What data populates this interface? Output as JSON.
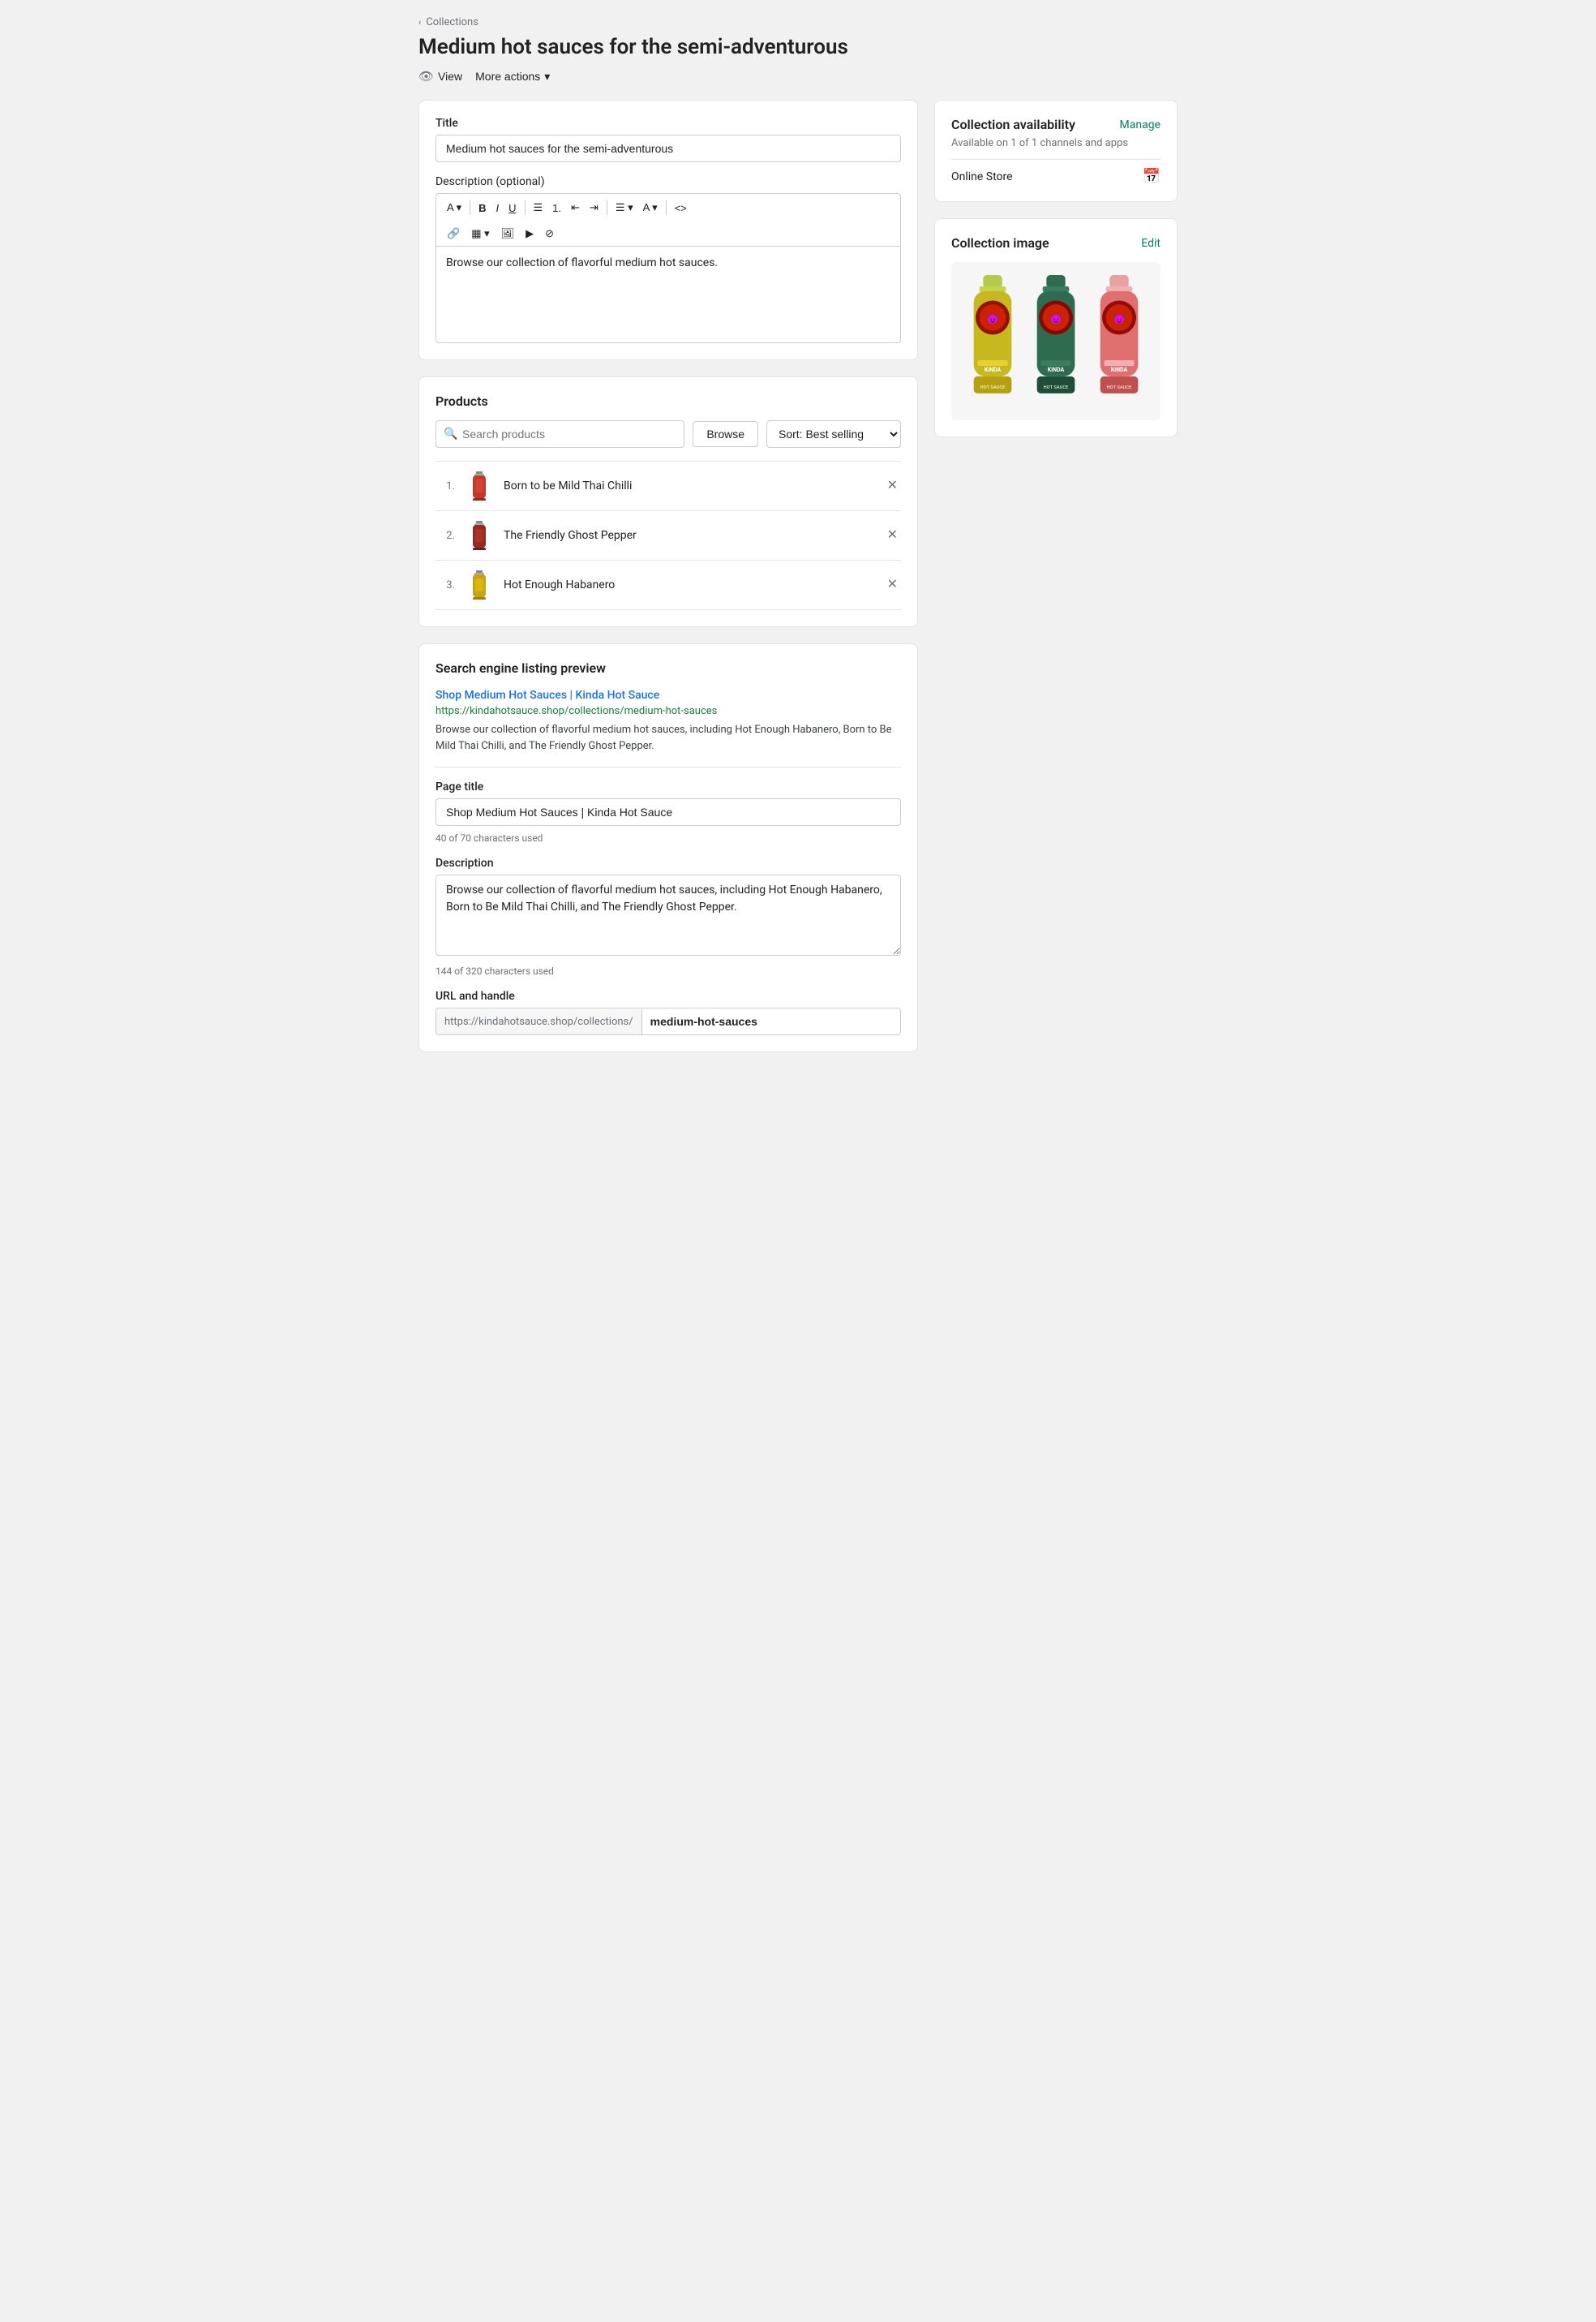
{
  "breadcrumb": {
    "label": "Collections",
    "chevron": "‹"
  },
  "page": {
    "title": "Medium hot sauces for the semi-adventurous"
  },
  "actions": {
    "view_label": "View",
    "more_actions_label": "More actions"
  },
  "title_field": {
    "label": "Title",
    "value": "Medium hot sauces for the semi-adventurous"
  },
  "description_field": {
    "label": "Description (optional)",
    "value": "Browse our collection of flavorful medium hot sauces."
  },
  "products": {
    "header": "Products",
    "search_placeholder": "Search products",
    "browse_label": "Browse",
    "sort_label": "Sort: Best selling",
    "items": [
      {
        "num": "1.",
        "name": "Born to be Mild Thai Chilli",
        "color": "#c0392b"
      },
      {
        "num": "2.",
        "name": "The Friendly Ghost Pepper",
        "color": "#922b21"
      },
      {
        "num": "3.",
        "name": "Hot Enough Habanero",
        "color": "#d4ac0d"
      }
    ]
  },
  "seo": {
    "header": "Search engine listing preview",
    "preview_title": "Shop Medium Hot Sauces | Kinda Hot Sauce",
    "preview_url": "https://kindahotsauce.shop/collections/medium-hot-sauces",
    "preview_desc": "Browse our collection of flavorful medium hot sauces, including Hot Enough Habanero, Born to Be Mild Thai Chilli, and The Friendly Ghost Pepper.",
    "page_title_label": "Page title",
    "page_title_value": "Shop Medium Hot Sauces | Kinda Hot Sauce",
    "page_title_chars": "40 of 70 characters used",
    "desc_label": "Description",
    "desc_value": "Browse our collection of flavorful medium hot sauces, including Hot Enough Habanero, Born to Be Mild Thai Chilli, and The Friendly Ghost Pepper.",
    "desc_chars": "144 of 320 characters used",
    "url_label": "URL and handle",
    "url_prefix": "https://kindahotsauce.shop/collections/",
    "url_handle": "medium-hot-sauces"
  },
  "availability": {
    "title": "Collection availability",
    "manage_label": "Manage",
    "subtitle": "Available on 1 of 1 channels and apps",
    "channel_name": "Online Store",
    "calendar_icon": "📅"
  },
  "collection_image": {
    "title": "Collection image",
    "edit_label": "Edit"
  },
  "toolbar": {
    "bold": "B",
    "italic": "I",
    "underline": "U",
    "bullets": "≡",
    "ordered": "1.",
    "indent_out": "⇤",
    "indent_in": "⇥",
    "align": "≡",
    "text_color": "A",
    "code": "<>",
    "link": "🔗",
    "table": "▦",
    "image": "🖼",
    "video": "▶",
    "block": "⊘"
  }
}
